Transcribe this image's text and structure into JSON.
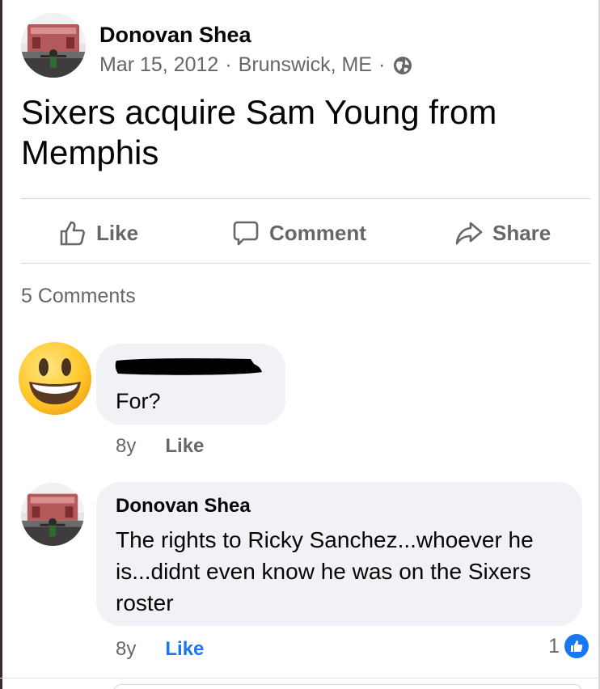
{
  "post": {
    "author": "Donovan Shea",
    "date": "Mar 15, 2012",
    "separator": "·",
    "location": "Brunswick, ME",
    "audience_icon": "globe-icon",
    "text": "Sixers acquire Sam Young from Memphis"
  },
  "actions": {
    "like_label": "Like",
    "comment_label": "Comment",
    "share_label": "Share"
  },
  "comments_summary": "5 Comments",
  "comments": [
    {
      "author": "",
      "author_redacted": true,
      "avatar_icon": "smiley-emoji-icon",
      "text": "For?",
      "age": "8y",
      "like_label": "Like"
    },
    {
      "author": "Donovan Shea",
      "text": "The rights to Ricky Sanchez...whoever he is...didnt even know he was on the Sixers roster",
      "age": "8y",
      "like_label": "Like",
      "reaction_count": "1",
      "reaction_icon": "like-reaction-icon"
    }
  ],
  "colors": {
    "secondary_text": "#65676b",
    "bubble": "#f0f2f5",
    "brand_blue": "#1877f2"
  }
}
